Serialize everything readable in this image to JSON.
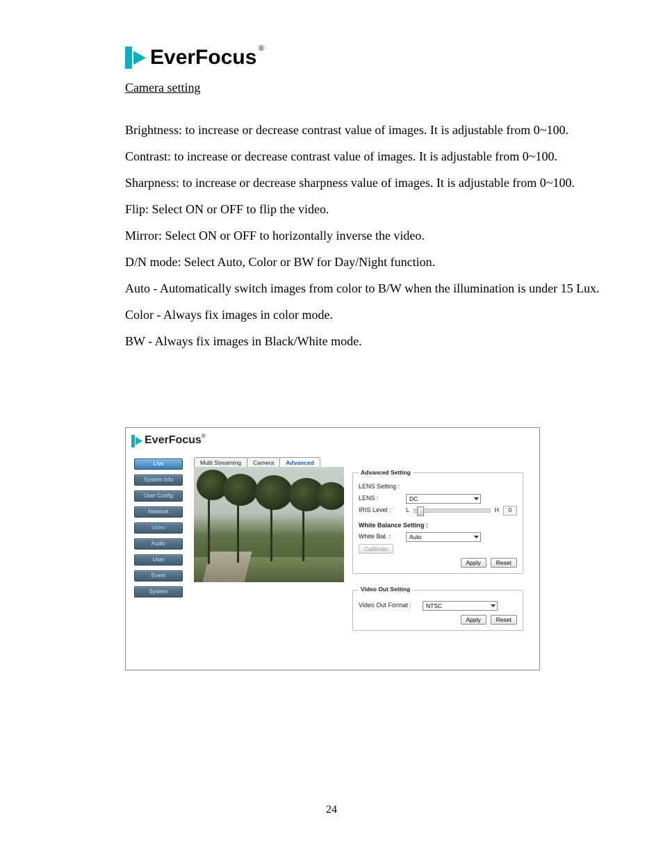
{
  "header": {
    "brand": "EverFocus",
    "reg": "®"
  },
  "doc": {
    "section_title": "Camera setting",
    "paragraphs": [
      "Brightness: to increase or decrease contrast value of images. It is adjustable from 0~100.",
      "Contrast: to increase or decrease contrast value of images. It is adjustable from 0~100.",
      "Sharpness: to increase or decrease sharpness value of images. It is adjustable from 0~100.",
      "Flip: Select ON or OFF to flip the video.",
      "Mirror: Select ON or OFF to horizontally inverse the video.",
      "D/N mode: Select Auto, Color or BW for Day/Night function."
    ],
    "dn_sub": [
      "Auto - Automatically switch images from color to B/W when the illumination is under 15 Lux.",
      "Color - Always fix images in color mode.",
      "BW - Always fix images in Black/White mode."
    ],
    "page_number": "24"
  },
  "ui": {
    "brand": "EverFocus",
    "reg": "®",
    "sidebar": [
      {
        "label": "Live"
      },
      {
        "label": "System Info"
      },
      {
        "label": "User Config"
      },
      {
        "label": "Network"
      },
      {
        "label": "Video"
      },
      {
        "label": "Audio"
      },
      {
        "label": "User"
      },
      {
        "label": "Event"
      },
      {
        "label": "System"
      }
    ],
    "tabs": [
      {
        "label": "Multi Streaming"
      },
      {
        "label": "Camera"
      },
      {
        "label": "Advanced",
        "active": true
      }
    ],
    "advanced": {
      "legend": "Advanced Setting",
      "lens_setting_label": "LENS Setting :",
      "lens_label": "LENS :",
      "lens_value": "DC",
      "iris_label": "IRIS Level :",
      "iris_L": "L",
      "iris_H": "H",
      "iris_value": "0",
      "wb_setting_label": "White Balance Setting :",
      "wb_label": "White Bal. :",
      "wb_value": "Auto",
      "calibrate_label": "Calibrate",
      "apply_label": "Apply",
      "reset_label": "Reset"
    },
    "video_out": {
      "legend": "Video Out Setting",
      "format_label": "Video Out Format :",
      "format_value": "NTSC",
      "apply_label": "Apply",
      "reset_label": "Reset"
    }
  }
}
